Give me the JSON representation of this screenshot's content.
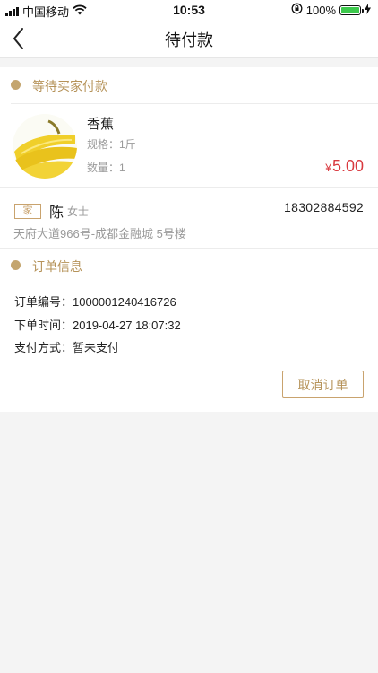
{
  "status_bar": {
    "carrier": "中国移动",
    "time": "10:53",
    "battery_percent": "100%",
    "battery_level": 1.0,
    "battery_color": "#3cc84c"
  },
  "nav": {
    "title": "待付款"
  },
  "status_section": {
    "title": "等待买家付款"
  },
  "product": {
    "name": "香蕉",
    "spec": "规格：1斤",
    "qty": "数量：1",
    "currency": "¥",
    "price": "5.00",
    "price_color": "#d9393f",
    "image": "banana-image"
  },
  "address": {
    "tag": "家",
    "name": "陈",
    "title": "女士",
    "phone": "18302884592",
    "line": "天府大道966号-成都金融城 5号楼"
  },
  "order_section": {
    "title": "订单信息",
    "rows": [
      "订单编号：1000001240416726",
      "下单时间：2019-04-27 18:07:32",
      "支付方式：暂未支付"
    ]
  },
  "actions": {
    "cancel_label": "取消订单"
  },
  "colors": {
    "accent_gold": "#c4a56e",
    "background": "#f4f4f4"
  }
}
